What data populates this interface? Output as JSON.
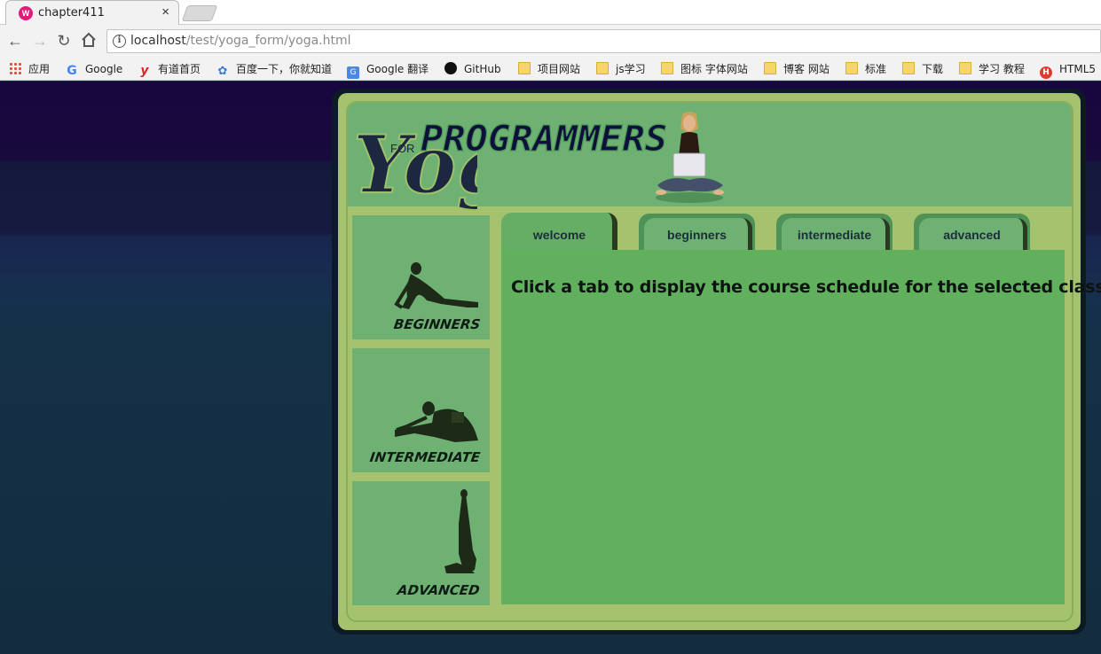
{
  "browser": {
    "tab_title": "chapter411",
    "tab_close": "×",
    "url_host": "localhost",
    "url_path": "/test/yoga_form/yoga.html"
  },
  "bookmarks": [
    {
      "label": "应用",
      "icon": "apps-icon"
    },
    {
      "label": "Google",
      "icon": "google-icon"
    },
    {
      "label": "有道首页",
      "icon": "youdao-icon"
    },
    {
      "label": "百度一下，你就知道",
      "icon": "baidu-icon"
    },
    {
      "label": "Google 翻译",
      "icon": "google-translate-icon"
    },
    {
      "label": "GitHub",
      "icon": "github-icon"
    },
    {
      "label": "项目网站",
      "icon": "folder-icon"
    },
    {
      "label": "js学习",
      "icon": "folder-icon"
    },
    {
      "label": "图标 字体网站",
      "icon": "folder-icon"
    },
    {
      "label": "博客 网站",
      "icon": "folder-icon"
    },
    {
      "label": "标准",
      "icon": "folder-icon"
    },
    {
      "label": "下载",
      "icon": "folder-icon"
    },
    {
      "label": "学习 教程",
      "icon": "folder-icon"
    },
    {
      "label": "HTML5",
      "icon": "html5-icon"
    }
  ],
  "site": {
    "logo_for": "FOR",
    "logo_yoga": "Yoga",
    "logo_programmers": "PROGRAMMERS"
  },
  "sidebar": [
    {
      "label": "BEGINNERS"
    },
    {
      "label": "INTERMEDIATE"
    },
    {
      "label": "ADVANCED"
    }
  ],
  "tabs": [
    {
      "label": "welcome",
      "active": true
    },
    {
      "label": "beginners",
      "active": false
    },
    {
      "label": "intermediate",
      "active": false
    },
    {
      "label": "advanced",
      "active": false
    }
  ],
  "content": {
    "message": "Click a tab to display the course schedule for the selected class."
  },
  "colors": {
    "frame": "#a5c36e",
    "panel": "#6eb172",
    "content": "#60b05e",
    "page_bg": "#132c3f"
  }
}
